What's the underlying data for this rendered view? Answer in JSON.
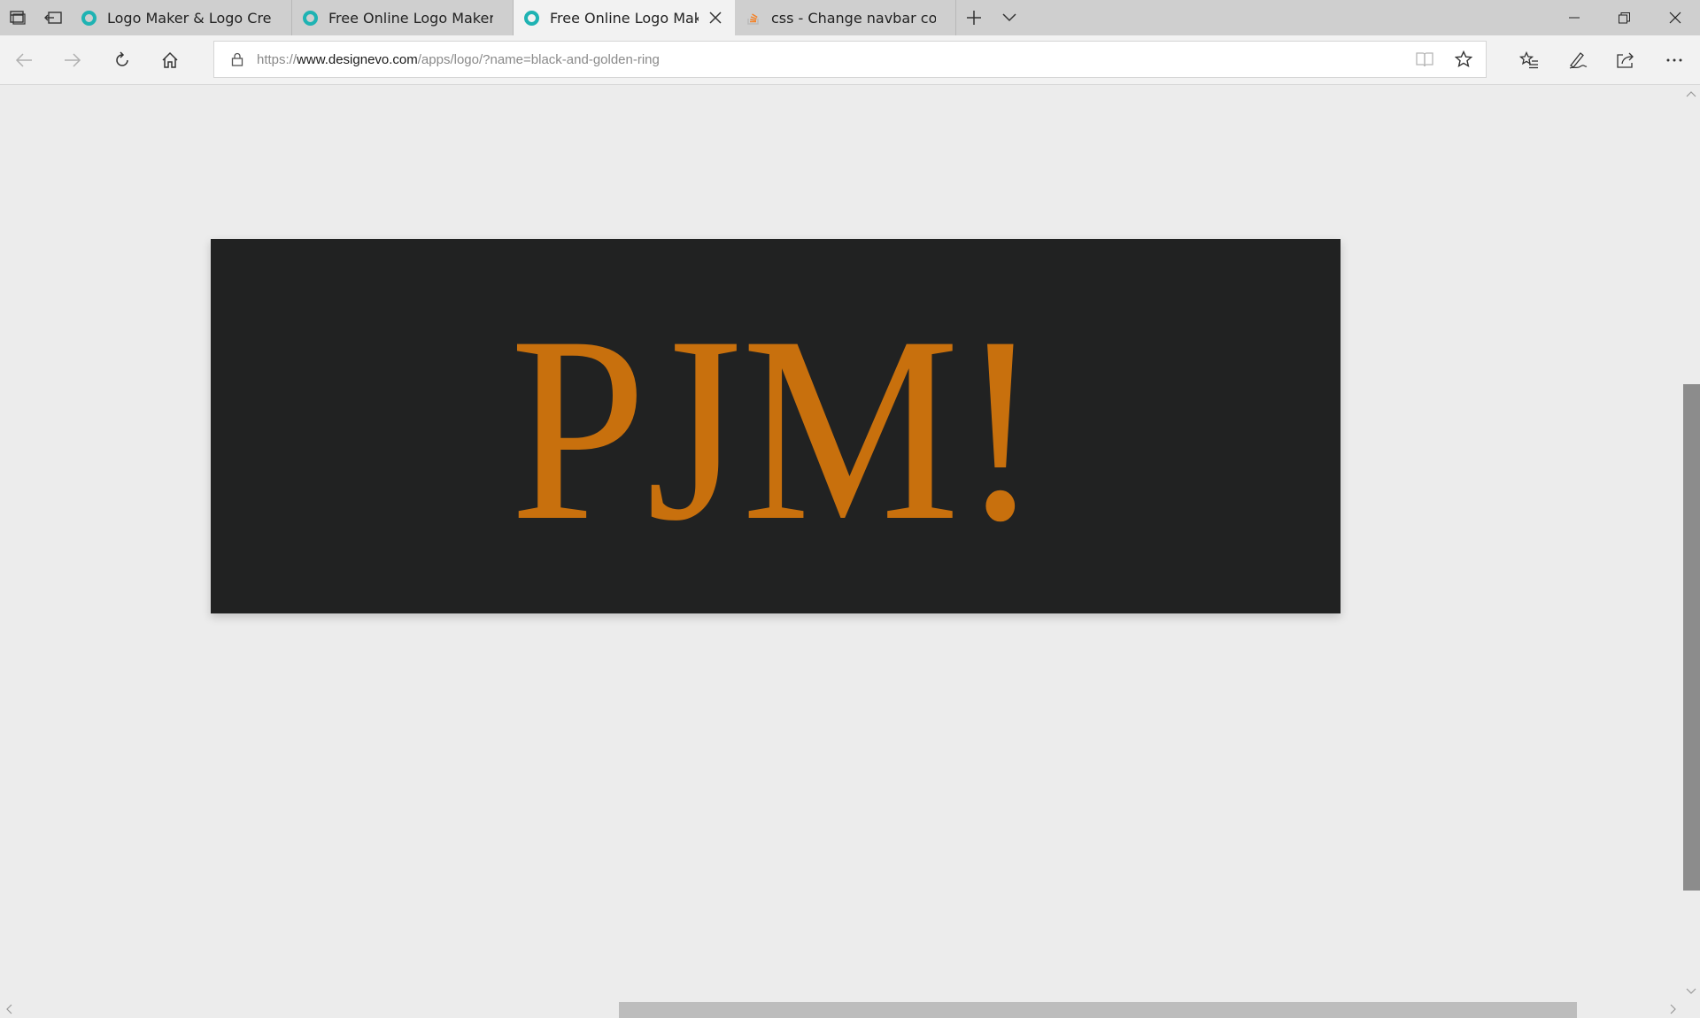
{
  "browser": {
    "tabs": [
      {
        "title": "Logo Maker & Logo Creator",
        "favicon": "designevo-ring-icon",
        "active": false
      },
      {
        "title": "Free Online Logo Maker, Create",
        "favicon": "designevo-ring-icon",
        "active": false
      },
      {
        "title": "Free Online Logo Maker",
        "favicon": "designevo-ring-icon",
        "active": true
      },
      {
        "title": "css - Change navbar color in",
        "favicon": "stackoverflow-icon",
        "active": false
      }
    ],
    "address": {
      "scheme": "https://",
      "domain": "www.designevo.com",
      "path": "/apps/logo/?name=black-and-golden-ring"
    },
    "icons": {
      "tab_manager": "tab-manager-icon",
      "set_aside": "set-aside-tabs-icon",
      "new_tab": "plus-icon",
      "tab_list": "chevron-down-icon",
      "back": "back-arrow-icon",
      "forward": "forward-arrow-icon",
      "refresh": "refresh-icon",
      "home": "home-icon",
      "reading_view": "reading-view-icon",
      "favorite": "star-icon",
      "favorites_hub": "favorites-list-icon",
      "notes": "pen-icon",
      "share": "share-icon",
      "more": "more-icon"
    }
  },
  "logo": {
    "text": "PJM!",
    "text_color": "#c8700d",
    "background_color": "#212222"
  }
}
